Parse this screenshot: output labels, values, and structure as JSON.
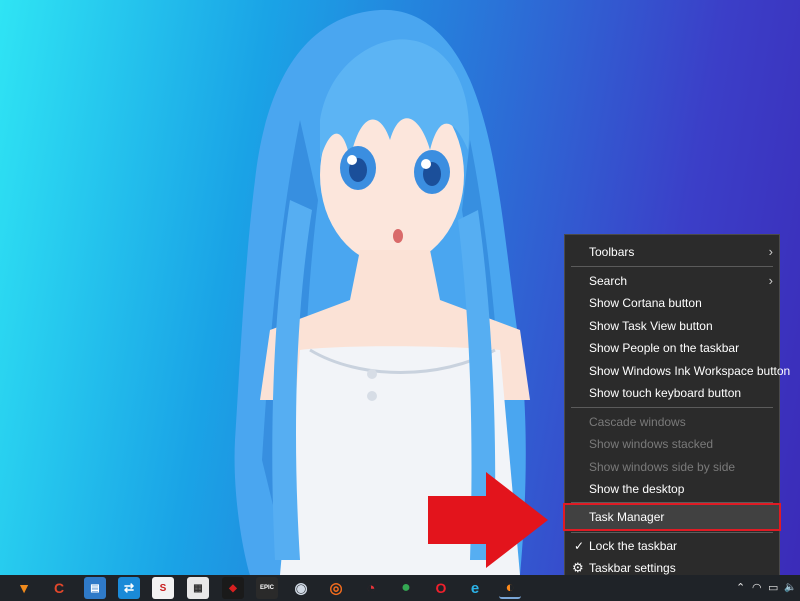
{
  "context_menu": {
    "items": [
      {
        "label": "Toolbars",
        "submenu": true
      },
      {
        "label": "Search",
        "submenu": true
      },
      {
        "label": "Show Cortana button"
      },
      {
        "label": "Show Task View button"
      },
      {
        "label": "Show People on the taskbar"
      },
      {
        "label": "Show Windows Ink Workspace button"
      },
      {
        "label": "Show touch keyboard button"
      },
      {
        "label": "Cascade windows",
        "disabled": true
      },
      {
        "label": "Show windows stacked",
        "disabled": true
      },
      {
        "label": "Show windows side by side",
        "disabled": true
      },
      {
        "label": "Show the desktop"
      },
      {
        "label": "Task Manager",
        "highlighted": true
      },
      {
        "label": "Lock the taskbar",
        "checked": true
      },
      {
        "label": "Taskbar settings",
        "icon": "gear-icon"
      }
    ],
    "chevron": "›",
    "checkmark": "✓",
    "gear": "⚙"
  },
  "colors": {
    "menu_bg": "#2b2b2b",
    "highlight_border": "#e01b24",
    "arrow": "#e3141c",
    "taskbar_bg": "#1f2328"
  },
  "taskbar": {
    "apps": [
      {
        "name": "vlc-icon",
        "glyph": "▼"
      },
      {
        "name": "ccleaner-icon",
        "glyph": "C"
      },
      {
        "name": "document-app-icon",
        "glyph": "▤"
      },
      {
        "name": "teamviewer-icon",
        "glyph": "⇄"
      },
      {
        "name": "sumatra-icon",
        "glyph": "S"
      },
      {
        "name": "utility-app-icon",
        "glyph": "▦"
      },
      {
        "name": "gaming-app-icon",
        "glyph": "◆"
      },
      {
        "name": "epic-games-icon",
        "glyph": "EPIC"
      },
      {
        "name": "steam-icon",
        "glyph": "◉"
      },
      {
        "name": "origin-icon",
        "glyph": "◎"
      },
      {
        "name": "speed-app-icon",
        "glyph": "◔"
      },
      {
        "name": "chrome-icon",
        "glyph": "●"
      },
      {
        "name": "opera-icon",
        "glyph": "O"
      },
      {
        "name": "edge-icon",
        "glyph": "e"
      },
      {
        "name": "firefox-icon",
        "glyph": "◐"
      }
    ],
    "tray": {
      "chevron_up": "⌃",
      "wifi": "◠",
      "battery": "▭",
      "volume": "🔈"
    }
  }
}
